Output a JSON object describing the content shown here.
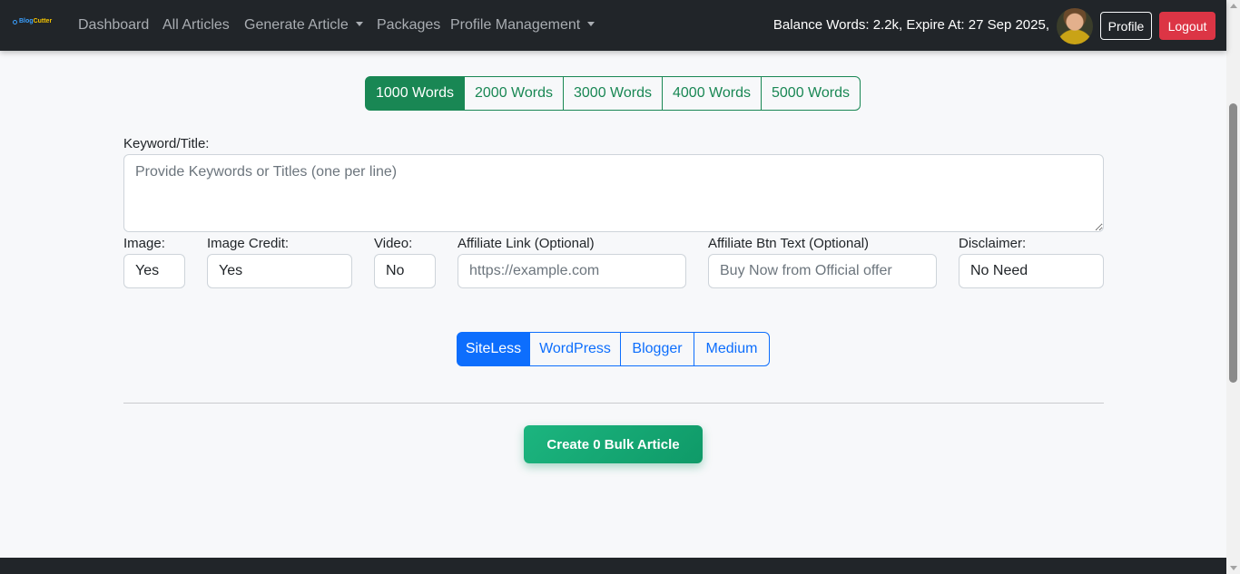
{
  "nav": {
    "brand": {
      "name_part1": "Blog",
      "name_part2": "Cutter"
    },
    "links": [
      "Dashboard",
      "All Articles",
      "Generate Article",
      "Packages",
      "Profile Management"
    ],
    "balance_text": "Balance Words: 2.2k,  Expire At: 27 Sep 2025,",
    "profile_label": "Profile",
    "logout_label": "Logout"
  },
  "word_counts": {
    "options": [
      "1000 Words",
      "2000 Words",
      "3000 Words",
      "4000 Words",
      "5000 Words"
    ],
    "selected": "1000 Words"
  },
  "form": {
    "keyword_label": "Keyword/Title:",
    "keyword_placeholder": "Provide Keywords or Titles (one per line)",
    "image_label": "Image:",
    "image_value": "Yes",
    "image_credit_label": "Image Credit:",
    "image_credit_value": "Yes",
    "video_label": "Video:",
    "video_value": "No",
    "affiliate_link_label": "Affiliate Link (Optional)",
    "affiliate_link_placeholder": "https://example.com",
    "affiliate_btn_label": "Affiliate Btn Text (Optional)",
    "affiliate_btn_placeholder": "Buy Now from Official offer",
    "disclaimer_label": "Disclaimer:",
    "disclaimer_value": "No Need"
  },
  "platforms": {
    "options": [
      "SiteLess",
      "WordPress",
      "Blogger",
      "Medium"
    ],
    "selected": "SiteLess"
  },
  "create_button": "Create 0 Bulk Article",
  "colors": {
    "navbar": "#212529",
    "success": "#198754",
    "primary": "#0d6efd",
    "danger": "#dc3545"
  }
}
